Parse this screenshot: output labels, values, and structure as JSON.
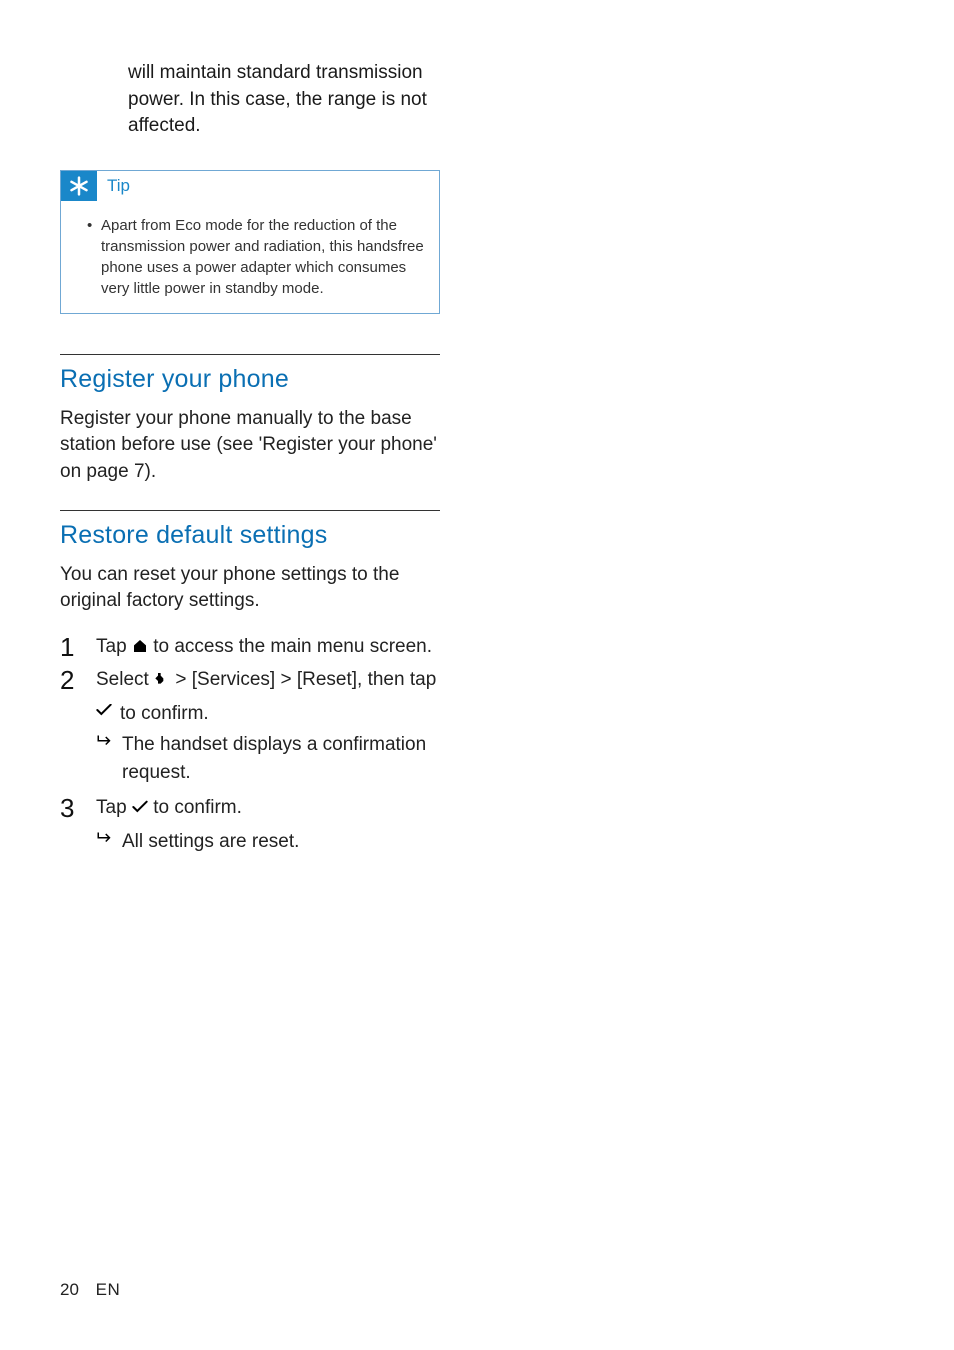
{
  "trail_text": "will maintain standard transmission power. In this case, the range is not affected.",
  "tip": {
    "label": "Tip",
    "body": "Apart from Eco mode for the reduction of the transmission power and radiation, this handsfree phone uses a power adapter which consumes very little power in standby mode."
  },
  "section1": {
    "heading": "Register your phone",
    "body": "Register your phone manually to the base station before use (see 'Register your phone' on page 7)."
  },
  "section2": {
    "heading": "Restore default settings",
    "intro": "You can reset your phone settings to the original factory settings.",
    "step1_a": "Tap ",
    "step1_b": " to access the main menu screen.",
    "step2_a": "Select ",
    "step2_b": " > ",
    "step2_services": "[Services]",
    "step2_c": " > ",
    "step2_reset": "[Reset]",
    "step2_d": ", then tap ",
    "step2_e": " to confirm.",
    "step2_result": "The handset displays a confirmation request.",
    "step3_a": "Tap ",
    "step3_b": " to confirm.",
    "step3_result": "All settings are reset."
  },
  "footer": {
    "page": "20",
    "lang": "EN"
  }
}
